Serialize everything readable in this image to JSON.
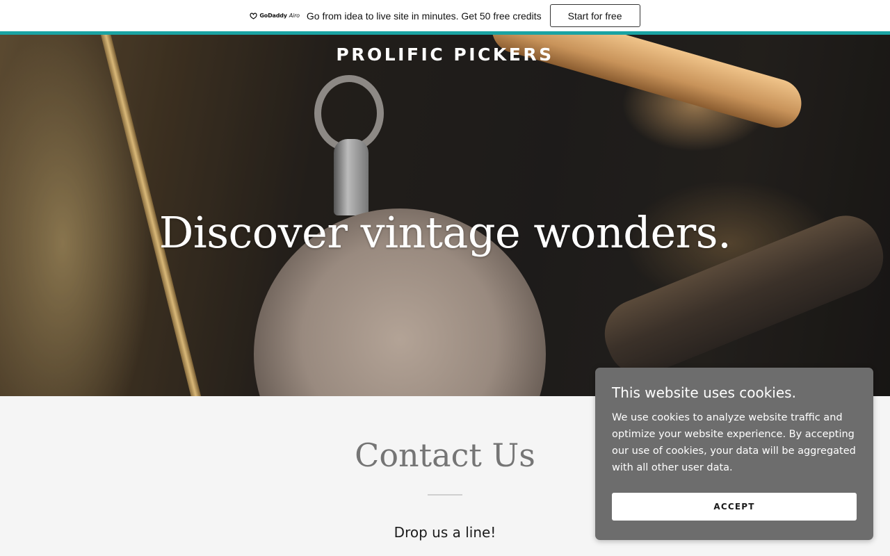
{
  "promo": {
    "logo_brand": "GoDaddy",
    "logo_product": "Airo",
    "text": "Go from idea to live site in minutes. Get 50 free credits",
    "button_label": "Start for free"
  },
  "header": {
    "brand": "PROLIFIC PICKERS"
  },
  "hero": {
    "headline": "Discover vintage wonders."
  },
  "contact": {
    "title": "Contact Us",
    "subtitle": "Drop us a line!"
  },
  "cookie": {
    "title": "This website uses cookies.",
    "body": "We use cookies to analyze website traffic and optimize your website experience. By accepting our use of cookies, your data will be aggregated with all other user data.",
    "accept_label": "ACCEPT"
  },
  "colors": {
    "accent_teal": "#1aa3a3",
    "cookie_bg": "#6d6d6d",
    "section_bg": "#f5f5f5"
  }
}
